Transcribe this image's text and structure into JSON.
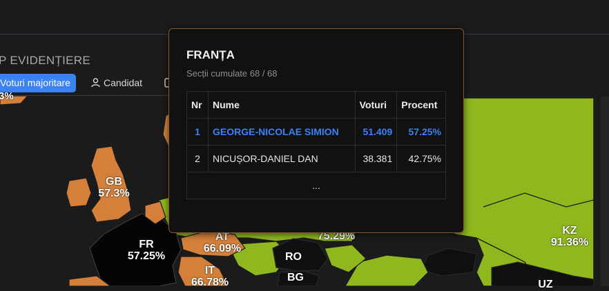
{
  "header": {
    "section_title": "P EVIDENȚIERE"
  },
  "tabs": {
    "active_label": "Voturi majoritare",
    "candidate_label": "Candidat"
  },
  "colors": {
    "simion": "#d4803a",
    "dan": "#8fb81f",
    "win_text": "#3b82f6",
    "tab_active": "#3b82f6"
  },
  "map_labels": {
    "top_fragment": "3%",
    "gb": {
      "code": "GB",
      "pct": "57.3%"
    },
    "fr": {
      "code": "FR",
      "pct": "57.25%"
    },
    "at": {
      "code": "AT",
      "pct": "66.09%"
    },
    "it": {
      "code": "IT",
      "pct": "66.78%"
    },
    "ro": {
      "code": "RO"
    },
    "bg": {
      "code": "BG"
    },
    "center_pct": "75.29%",
    "kz": {
      "code": "KZ",
      "pct": "91.36%"
    },
    "uz": {
      "code": "UZ"
    }
  },
  "popup": {
    "title": "FRANȚA",
    "subtitle": "Secții cumulate 68 / 68",
    "columns": [
      "Nr",
      "Nume",
      "Voturi",
      "Procent"
    ],
    "rows": [
      {
        "nr": "1",
        "name": "GEORGE-NICOLAE SIMION",
        "votes": "51.409",
        "percent": "57.25%"
      },
      {
        "nr": "2",
        "name": "NICUȘOR-DANIEL DAN",
        "votes": "38.381",
        "percent": "42.75%"
      }
    ],
    "ellipsis": "..."
  }
}
